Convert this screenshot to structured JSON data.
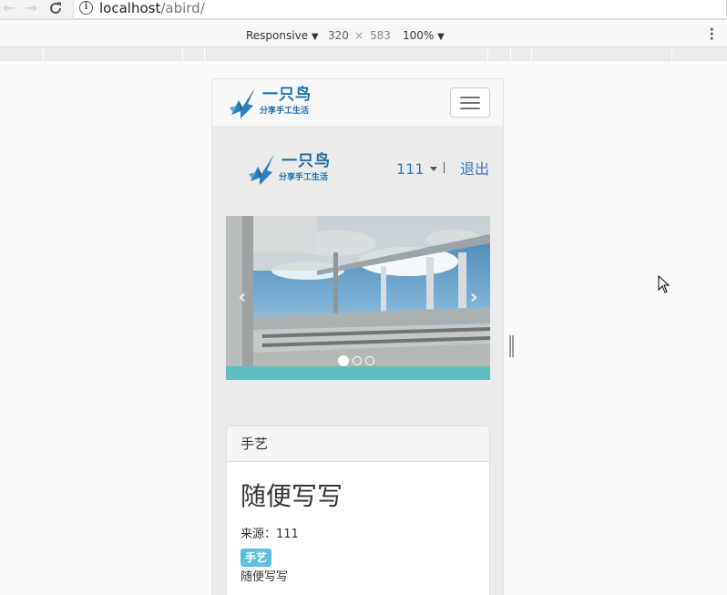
{
  "browser": {
    "url_host": "localhost",
    "url_path": "/abird/",
    "back_glyph": "←",
    "forward_glyph": "→",
    "reload_glyph": "C",
    "info_glyph": "i",
    "device_mode": "Responsive",
    "viewport_width": "320",
    "times_glyph": "×",
    "viewport_height": "583",
    "zoom": "100%",
    "dropdown_glyph": "▼",
    "menu_glyph": "⋮"
  },
  "site": {
    "logo_title": "一只鸟",
    "logo_slogan": "分享手工生活",
    "brand_color": "#2a7fc1",
    "toggler_icon": "hamburger-icon"
  },
  "user_bar": {
    "username": "111",
    "logout_label": "退出"
  },
  "carousel": {
    "prev_glyph": "‹",
    "next_glyph": "›",
    "slide_count": 3,
    "active_slide": 1,
    "bottom_band_color": "#5fbfc1"
  },
  "post": {
    "category": "手艺",
    "title": "随便写写",
    "source": "来源：111",
    "tag": "手艺",
    "body": "随便写写"
  }
}
